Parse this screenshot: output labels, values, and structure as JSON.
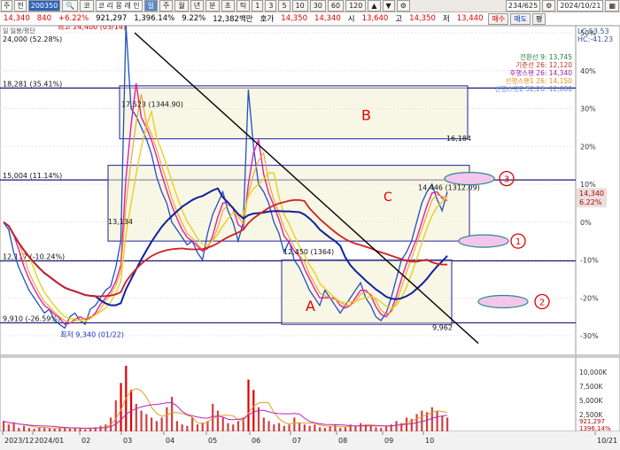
{
  "toolbar": {
    "items": [
      "주",
      "전",
      "200350",
      "코",
      "코 리 몽 레 인",
      "일",
      "주",
      "월",
      "년",
      "분",
      "초",
      "틱",
      "1",
      "3",
      "5",
      "10",
      "30",
      "60",
      "120",
      "234/625",
      "2024/10/21"
    ],
    "icons": [
      "search-icon",
      "up-icon",
      "down-icon",
      "settings-icon",
      "gear-icon"
    ]
  },
  "quote": {
    "price": "14,340",
    "change": "840",
    "change_pct": "+6.22%",
    "volume": "921,297",
    "volume_pct": "1,396.14%",
    "turnover_rate": "9.22%",
    "amount": "12,382백만",
    "bid_label": "호가",
    "bid": "14,350",
    "ask": "14,340",
    "open_label": "시",
    "open": "13,640",
    "high_label": "고",
    "high": "14,350",
    "low_label": "저",
    "low": "13,440",
    "buy_label": "매수",
    "sell_label": "매도",
    "end_label": "평"
  },
  "chart_data": {
    "type": "candlestick",
    "title": "",
    "top_left_label": "일 일봉/평단",
    "y_top_value": "24,000 (52.28%)",
    "ylim_pct": [
      -30,
      50
    ],
    "y_ticks_pct": [
      "50%",
      "40%",
      "30%",
      "20%",
      "10%",
      "0%",
      "-10%",
      "-20%",
      "-30%"
    ],
    "x_ticks": [
      "2023/12",
      "2024/01",
      "02",
      "03",
      "04",
      "05",
      "06",
      "07",
      "08",
      "09",
      "10",
      "10/21"
    ],
    "indicators": {
      "lc": "LC:53.53",
      "hc": "HC:-41.23",
      "conversion": "전환선 9: 13,745",
      "base": "기준선 26: 12,120",
      "lagging": "후행스팬 26: 14,340",
      "leading1": "선행스팬1 26: 14,150",
      "leading2": "선행스팬2 52,26: 12,080"
    },
    "levels": [
      {
        "label": "18,281 (35.41%)",
        "pct": 35.41,
        "color": "#1a1a7a"
      },
      {
        "label": "15,004 (11.14%)",
        "pct": 11.14,
        "color": "#1a1a7a"
      },
      {
        "label": "12,117 (-10.24%)",
        "pct": -10.24,
        "color": "#1a1a7a"
      },
      {
        "label": "9,910 (-26.59%)",
        "pct": -26.59,
        "color": "#1a1a7a"
      },
      {
        "label": "",
        "pct": 52.28,
        "color": "#1a1a7a"
      }
    ],
    "annotations": {
      "high": "최고 24,400 (03/14)",
      "low": "최저 9,340 (01/22)",
      "box1": "17,523 (1344.90)",
      "box2_left": "13,134",
      "box2_right": "16,184",
      "box3": "12,450 (1364)",
      "box3_right": "9,962",
      "last": "14,446 (1312.09)",
      "right_price": "14,340",
      "right_pct": "6.22%",
      "letter_b": "B",
      "letter_c": "C",
      "letter_a": "A",
      "circle_1": "1",
      "circle_2": "2",
      "circle_3": "3"
    },
    "series": [
      {
        "name": "",
        "type": "price",
        "color": "#2050c0"
      },
      {
        "name": "",
        "type": "ma-red",
        "color": "#d02020"
      },
      {
        "name": "",
        "type": "ma-blue",
        "color": "#1020a0"
      },
      {
        "name": "",
        "type": "ma-yellow",
        "color": "#e8d020"
      },
      {
        "name": "",
        "type": "ma-orange",
        "color": "#f0a020"
      },
      {
        "name": "",
        "type": "ma-magenta",
        "color": "#e020a0"
      }
    ],
    "price_pct": [
      0,
      -2,
      -8,
      -12,
      -15,
      -18,
      -20,
      -22,
      -24,
      -23,
      -26,
      -27,
      -28,
      -25,
      -24,
      -26,
      -27,
      -23,
      -22,
      -20,
      -18,
      -17,
      -12,
      -5,
      52,
      30,
      28,
      25,
      22,
      18,
      12,
      8,
      5,
      0,
      -2,
      -4,
      -6,
      -5,
      -8,
      -10,
      -3,
      2,
      5,
      8,
      3,
      0,
      -5,
      0,
      35,
      20,
      10,
      8,
      5,
      0,
      -3,
      -8,
      -5,
      -10,
      -12,
      -15,
      -18,
      -20,
      -22,
      -18,
      -20,
      -22,
      -24,
      -22,
      -20,
      -18,
      -16,
      -20,
      -22,
      -25,
      -26,
      -24,
      -20,
      -15,
      -10,
      -8,
      -5,
      0,
      5,
      8,
      10,
      6,
      3,
      8
    ],
    "volume_pct": [
      0.15,
      0.1,
      0.12,
      0.05,
      0.08,
      0.05,
      0.04,
      0.06,
      0.05,
      0.05,
      0.04,
      0.05,
      0.06,
      0.04,
      0.05,
      0.04,
      0.03,
      0.05,
      0.06,
      0.08,
      0.1,
      0.2,
      0.45,
      0.7,
      0.95,
      0.6,
      0.4,
      0.3,
      0.25,
      0.2,
      0.15,
      0.2,
      0.35,
      0.5,
      0.15,
      0.1,
      0.08,
      0.2,
      0.1,
      0.12,
      0.15,
      0.4,
      0.3,
      0.2,
      0.12,
      0.1,
      0.15,
      0.2,
      0.75,
      0.6,
      0.35,
      0.2,
      0.15,
      0.1,
      0.12,
      0.08,
      0.1,
      0.2,
      0.12,
      0.1,
      0.08,
      0.1,
      0.06,
      0.05,
      0.08,
      0.1,
      0.05,
      0.06,
      0.1,
      0.08,
      0.12,
      0.1,
      0.08,
      0.06,
      0.05,
      0.08,
      0.1,
      0.15,
      0.12,
      0.2,
      0.18,
      0.25,
      0.3,
      0.28,
      0.35,
      0.3,
      0.22,
      0.2
    ],
    "volume_axis": [
      "10,000K",
      "7,500K",
      "5,000K",
      "2,500K"
    ],
    "volume_last": "921,297",
    "volume_last_pct": "1396.14%"
  }
}
